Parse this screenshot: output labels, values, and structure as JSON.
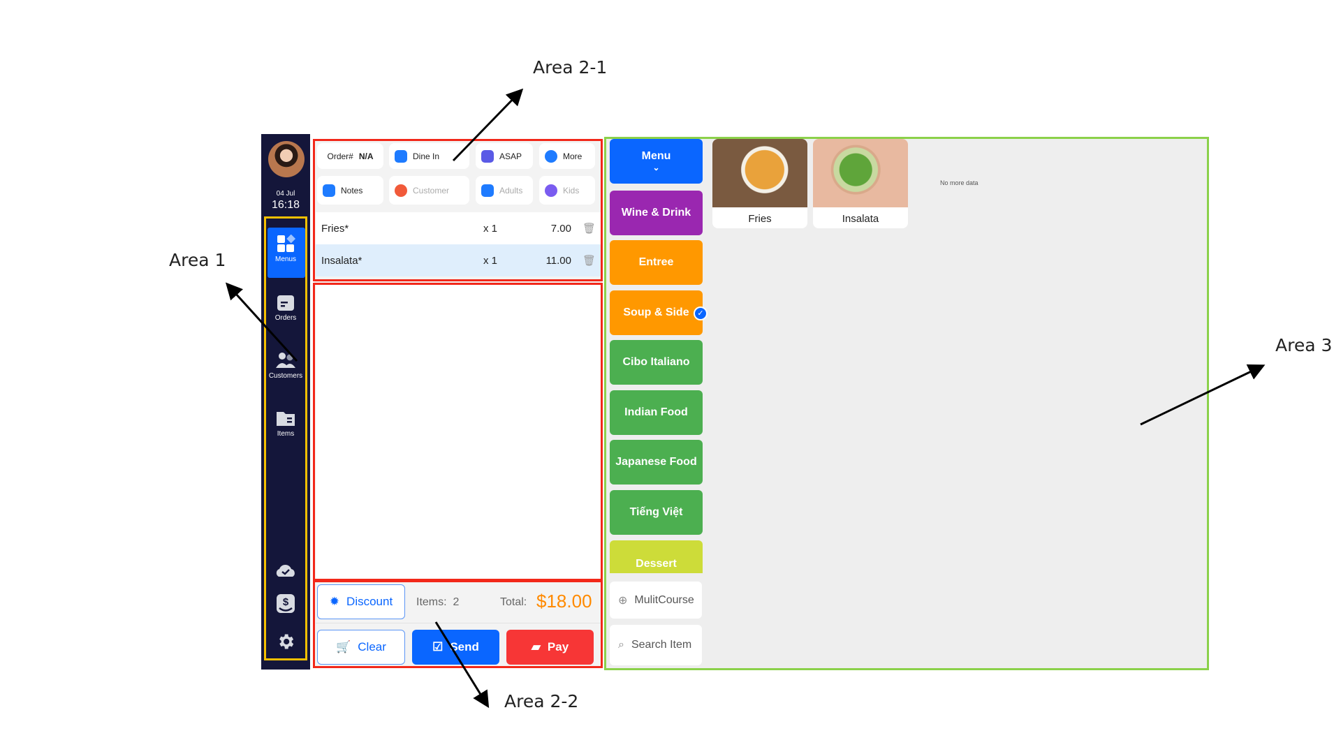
{
  "annotations": {
    "area1": "Area 1",
    "area2_1": "Area 2-1",
    "area2_2": "Area 2-2",
    "area3": "Area 3"
  },
  "sidebar": {
    "date": "04 Jul",
    "time": "16:18",
    "items": [
      {
        "label": "Menus",
        "icon": "menus-icon",
        "active": true
      },
      {
        "label": "Orders",
        "icon": "orders-icon"
      },
      {
        "label": "Customers",
        "icon": "customers-icon"
      },
      {
        "label": "Items",
        "icon": "items-icon"
      }
    ],
    "bottom_icons": [
      "cloud-sync-icon",
      "cash-drawer-icon",
      "gear-icon"
    ]
  },
  "order": {
    "order_label": "Order#",
    "order_number": "N/A",
    "dine_in": "Dine In",
    "asap": "ASAP",
    "more": "More",
    "notes": "Notes",
    "customer": "Customer",
    "adults": "Adults",
    "kids": "Kids",
    "lines": [
      {
        "name": "Fries*",
        "qty": "x 1",
        "price": "7.00"
      },
      {
        "name": "Insalata*",
        "qty": "x 1",
        "price": "11.00"
      }
    ],
    "discount": "Discount",
    "items_label": "Items:",
    "items_count": "2",
    "total_label": "Total:",
    "total": "$18.00",
    "clear": "Clear",
    "send": "Send",
    "pay": "Pay"
  },
  "categories": [
    {
      "label": "Menu",
      "color": "#0a66ff"
    },
    {
      "label": "Wine & Drink",
      "color": "#9a27b0"
    },
    {
      "label": "Entree",
      "color": "#ff9800"
    },
    {
      "label": "Soup & Side",
      "color": "#ff9800",
      "selected": true
    },
    {
      "label": "Cibo Italiano",
      "color": "#4caf50"
    },
    {
      "label": "Indian Food",
      "color": "#4caf50"
    },
    {
      "label": "Japanese Food",
      "color": "#4caf50"
    },
    {
      "label": "Tiếng Việt",
      "color": "#4caf50"
    },
    {
      "label": "Dessert",
      "color": "#cddc39"
    }
  ],
  "multicourse": "MulitCourse",
  "search_placeholder": "Search Item",
  "products": [
    {
      "name": "Fries"
    },
    {
      "name": "Insalata"
    }
  ],
  "no_more_data": "No more data",
  "colors": {
    "primary": "#0a66ff",
    "pay": "#f73636",
    "total": "#ff8a00",
    "area1": "#f5c000",
    "area2": "#f2281a",
    "area3": "#8bd14a"
  }
}
